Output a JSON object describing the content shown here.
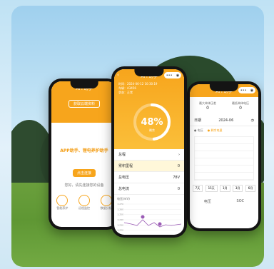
{
  "background": {
    "sky_color": "#c8e6f6",
    "grass_color": "#6a9f3c"
  },
  "left_phone": {
    "title": "APP助手",
    "top_button_label": "获取云端资料",
    "headline": "APP助手、锂电养护助手",
    "primary_button_label": "点击连接",
    "caption": "您好，请先连接您的设备",
    "icons": [
      {
        "label": "智能养护",
        "icon": "battery-icon"
      },
      {
        "label": "远程监控",
        "icon": "monitor-icon"
      },
      {
        "label": "数据分析",
        "icon": "chart-icon"
      }
    ]
  },
  "center_phone": {
    "title": "APP助手",
    "info_lines": [
      "时间：2024-06-12 10:30:19",
      "车辆：A3456",
      "状态：正常"
    ],
    "gauge": {
      "percent_label": "48%",
      "value": 48,
      "sublabel": "剩余"
    },
    "rows": [
      {
        "label": "总程",
        "value": ""
      },
      {
        "label": "累积里程",
        "value": "0"
      },
      {
        "label": "总电压",
        "value": "78V"
      },
      {
        "label": "总电流",
        "value": "0"
      }
    ],
    "chart": {
      "ylabel": "电压(mV)",
      "yticks": [
        "3,270",
        "3,260",
        "3,250",
        "3,240",
        "3,230",
        "3,220",
        "3,210"
      ],
      "xticks": [
        "#1",
        "#2",
        "#3",
        "#4",
        "#5",
        "#6",
        "#7",
        "#8",
        "#9",
        "#10",
        "#11",
        "#12",
        "#13",
        "#14",
        "#15"
      ]
    }
  },
  "right_phone": {
    "title": "APP助手",
    "stats": [
      {
        "label": "最大单体压差",
        "value": "0"
      },
      {
        "label": "最低单体电压",
        "value": "0"
      }
    ],
    "filter_label": "日期",
    "date_value": "2024-06",
    "legend": [
      "电压",
      "剩余电量"
    ],
    "tabs": [
      "7天",
      "15天",
      "1月",
      "3月",
      "6月"
    ],
    "bottom_labels": [
      "电压",
      "SOC"
    ]
  },
  "colors": {
    "accent": "#f7a51c",
    "chart_line": "#9a5bb5",
    "highlight": "#fff7d9"
  }
}
